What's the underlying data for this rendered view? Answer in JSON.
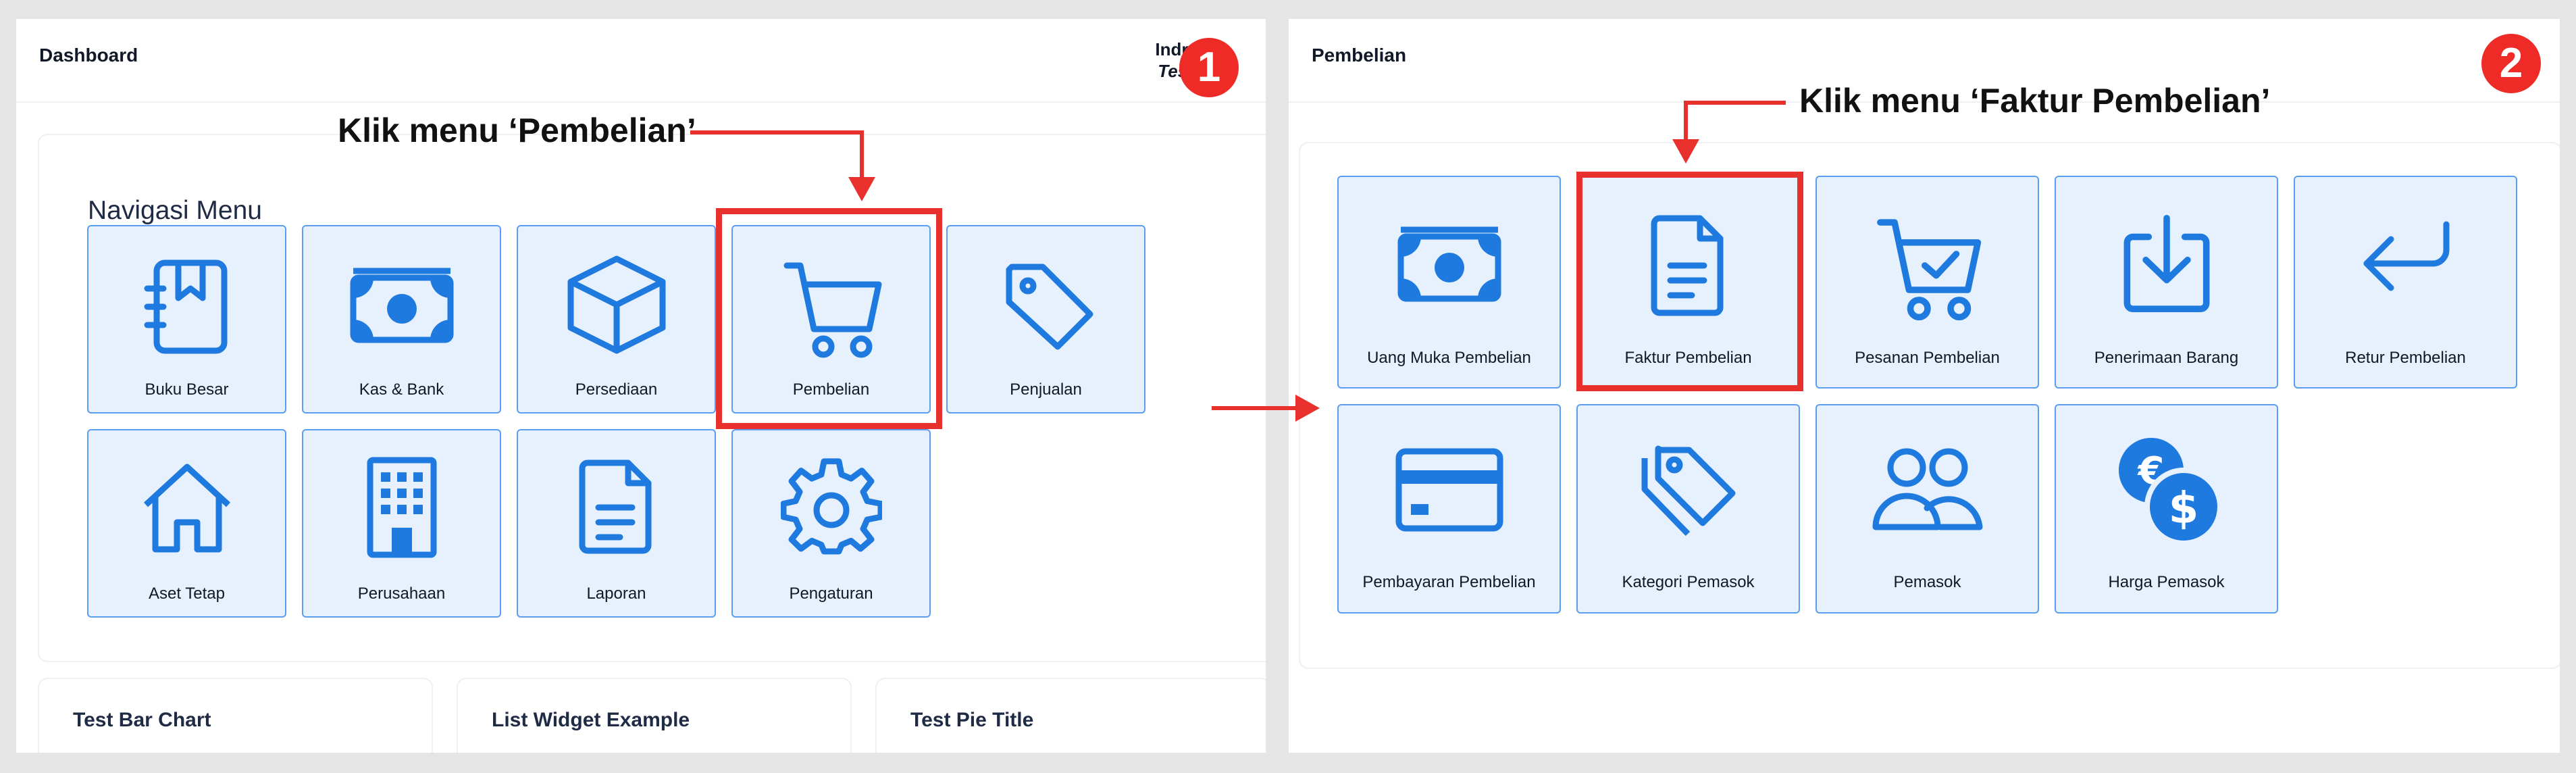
{
  "colors": {
    "accent": "#1f7ae0",
    "tile_bg": "#e7f1fd",
    "tile_border": "#5b9ef0",
    "highlight": "#e8312c"
  },
  "step1": {
    "badge": "1",
    "page_title": "Dashboard",
    "user_name": "Indra",
    "user_role": "Testi",
    "annotation": "Klik menu ‘Pembelian’",
    "section_title": "Navigasi Menu",
    "tiles": [
      {
        "label": "Buku Besar",
        "icon": "book-icon"
      },
      {
        "label": "Kas & Bank",
        "icon": "banknote-icon"
      },
      {
        "label": "Persediaan",
        "icon": "box-icon"
      },
      {
        "label": "Pembelian",
        "icon": "cart-icon"
      },
      {
        "label": "Penjualan",
        "icon": "tag-icon"
      },
      {
        "label": "Aset Tetap",
        "icon": "house-icon"
      },
      {
        "label": "Perusahaan",
        "icon": "building-icon"
      },
      {
        "label": "Laporan",
        "icon": "document-icon"
      },
      {
        "label": "Pengaturan",
        "icon": "gear-icon"
      }
    ],
    "widgets": [
      {
        "title": "Test Bar Chart"
      },
      {
        "title": "List Widget Example"
      },
      {
        "title": "Test Pie Title"
      }
    ]
  },
  "step2": {
    "badge": "2",
    "page_title": "Pembelian",
    "annotation": "Klik menu ‘Faktur Pembelian’",
    "tiles": [
      {
        "label": "Uang Muka Pembelian",
        "icon": "banknote-icon"
      },
      {
        "label": "Faktur Pembelian",
        "icon": "document-icon"
      },
      {
        "label": "Pesanan Pembelian",
        "icon": "cart-check-icon"
      },
      {
        "label": "Penerimaan Barang",
        "icon": "download-tray-icon"
      },
      {
        "label": "Retur Pembelian",
        "icon": "return-arrow-icon"
      },
      {
        "label": "Pembayaran Pembelian",
        "icon": "credit-card-icon"
      },
      {
        "label": "Kategori Pemasok",
        "icon": "tags-icon"
      },
      {
        "label": "Pemasok",
        "icon": "users-icon"
      },
      {
        "label": "Harga Pemasok",
        "icon": "currency-coins-icon"
      }
    ]
  }
}
